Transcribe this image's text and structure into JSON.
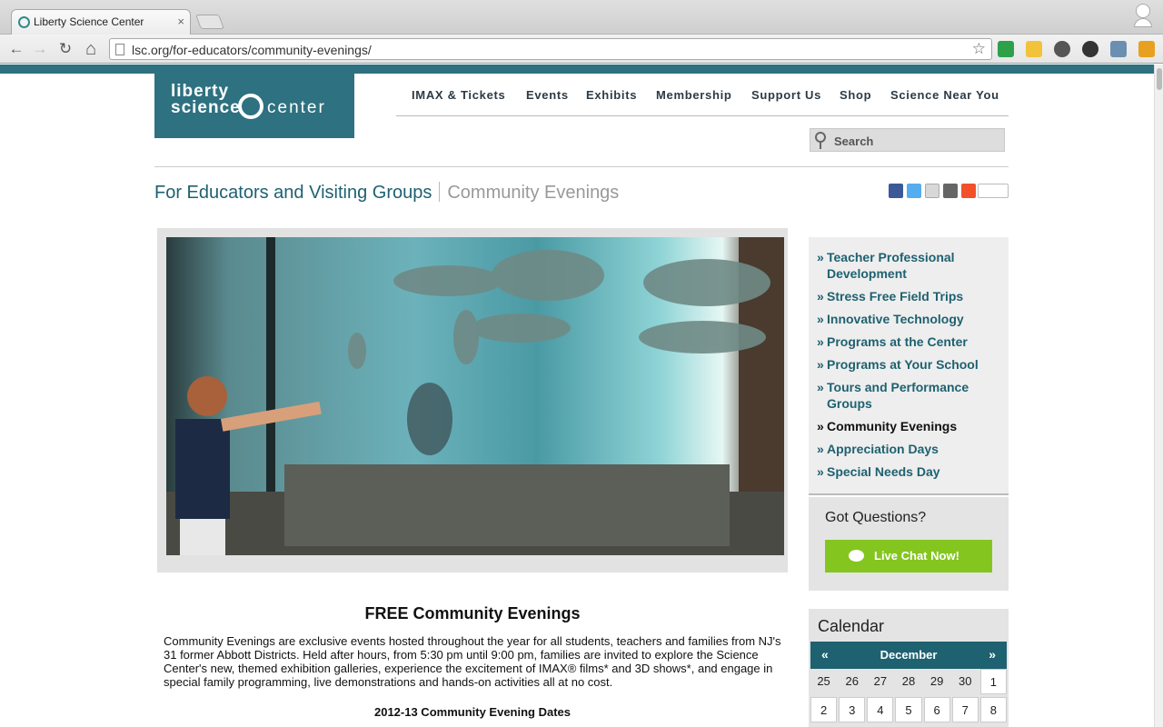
{
  "browser": {
    "tab_title": "Liberty Science Center",
    "tab_close": "×",
    "url": "lsc.org/for-educators/community-evenings/",
    "back": "←",
    "forward": "→",
    "reload": "↻",
    "home": "⌂",
    "star": "☆"
  },
  "site": {
    "logo": {
      "line1": "liberty",
      "line2": "science",
      "line3": "center"
    },
    "nav": [
      "IMAX & Tickets",
      "Events",
      "Exhibits",
      "Membership",
      "Support Us",
      "Shop",
      "Science Near You"
    ],
    "search_placeholder": "Search"
  },
  "breadcrumb": {
    "section": "For Educators and Visiting Groups",
    "page": "Community Evenings"
  },
  "share_icons": [
    "facebook-icon",
    "twitter-icon",
    "email-icon",
    "print-icon",
    "addthis-icon"
  ],
  "content": {
    "heading": "FREE Community Evenings",
    "paragraph": "Community Evenings are exclusive events hosted throughout the year for all students, teachers and families from NJ's 31 former Abbott Districts. Held after hours, from 5:30 pm until 9:00 pm, families are invited to explore the Science Center's new, themed exhibition galleries, experience the excitement of IMAX® films* and 3D shows*, and engage in special family programming, live demonstrations and hands-on activities all at no cost.",
    "dates_heading": "2012-13 Community Evening Dates"
  },
  "sidebar": {
    "bullet": "»",
    "items": [
      {
        "label": "Teacher Professional Development",
        "active": false
      },
      {
        "label": "Stress Free Field Trips",
        "active": false
      },
      {
        "label": "Innovative Technology",
        "active": false
      },
      {
        "label": "Programs at the Center",
        "active": false
      },
      {
        "label": "Programs at Your School",
        "active": false
      },
      {
        "label": "Tours and Performance Groups",
        "active": false
      },
      {
        "label": "Community Evenings",
        "active": true
      },
      {
        "label": "Appreciation Days",
        "active": false
      },
      {
        "label": "Special Needs Day",
        "active": false
      }
    ],
    "questions_title": "Got Questions?",
    "chat_button": "Live Chat Now!",
    "calendar": {
      "title": "Calendar",
      "prev": "«",
      "month": "December",
      "next": "»",
      "days": [
        "25",
        "26",
        "27",
        "28",
        "29",
        "30",
        "1",
        "2",
        "3",
        "4",
        "5",
        "6",
        "7",
        "8"
      ]
    }
  },
  "colors": {
    "brand_teal": "#2e7180",
    "link_teal": "#1e6170",
    "chat_green": "#84c61f"
  }
}
